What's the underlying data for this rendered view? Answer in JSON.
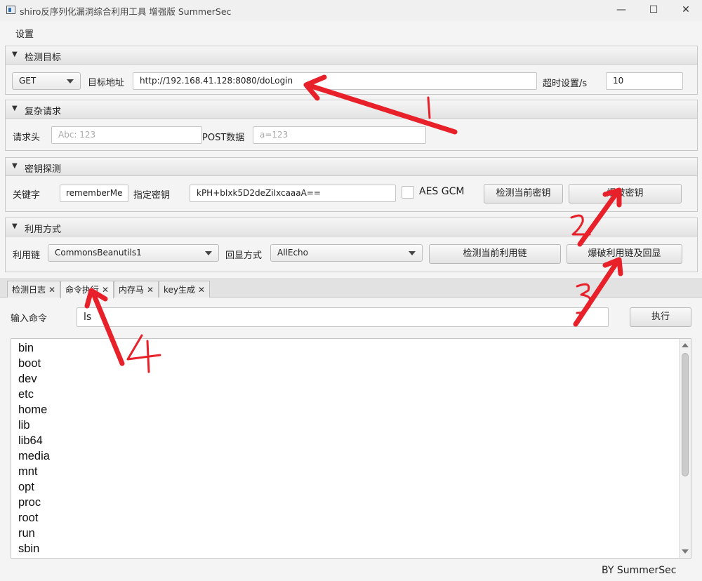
{
  "window": {
    "title": "shiro反序列化漏洞综合利用工具 增强版 SummerSec",
    "controls": {
      "minimize": "—",
      "maximize": "☐",
      "close": "✕"
    }
  },
  "menu": {
    "settings": "设置"
  },
  "target": {
    "header": "检测目标",
    "method": "GET",
    "url_label": "目标地址",
    "url_value": "http://192.168.41.128:8080/doLogin",
    "timeout_label": "超时设置/s",
    "timeout_value": "10"
  },
  "complex": {
    "header": "复杂请求",
    "headers_label": "请求头",
    "headers_placeholder": "Abc: 123",
    "post_label": "POST数据",
    "post_placeholder": "a=123"
  },
  "key": {
    "header": "密钥探测",
    "keyword_label": "关键字",
    "keyword_value": "rememberMe",
    "specify_label": "指定密钥",
    "key_value": "kPH+bIxk5D2deZiIxcaaaA==",
    "aes_gcm_label": "AES GCM",
    "check_key_button": "检测当前密钥",
    "brute_key_button": "爆破密钥"
  },
  "exploit": {
    "header": "利用方式",
    "chain_label": "利用链",
    "chain_value": "CommonsBeanutils1",
    "echo_label": "回显方式",
    "echo_value": "AllEcho",
    "check_chain_button": "检测当前利用链",
    "brute_chain_button": "爆破利用链及回显"
  },
  "tabs": [
    {
      "label": "检测日志",
      "active": false
    },
    {
      "label": "命令执行",
      "active": true
    },
    {
      "label": "内存马",
      "active": false
    },
    {
      "label": "key生成",
      "active": false
    }
  ],
  "command": {
    "label": "输入命令",
    "value": "ls",
    "execute_button": "执行"
  },
  "output_lines": [
    "bin",
    "boot",
    "dev",
    "etc",
    "home",
    "lib",
    "lib64",
    "media",
    "mnt",
    "opt",
    "proc",
    "root",
    "run",
    "sbin"
  ],
  "footer": "BY   SummerSec",
  "annotation_color": "#e8202a"
}
